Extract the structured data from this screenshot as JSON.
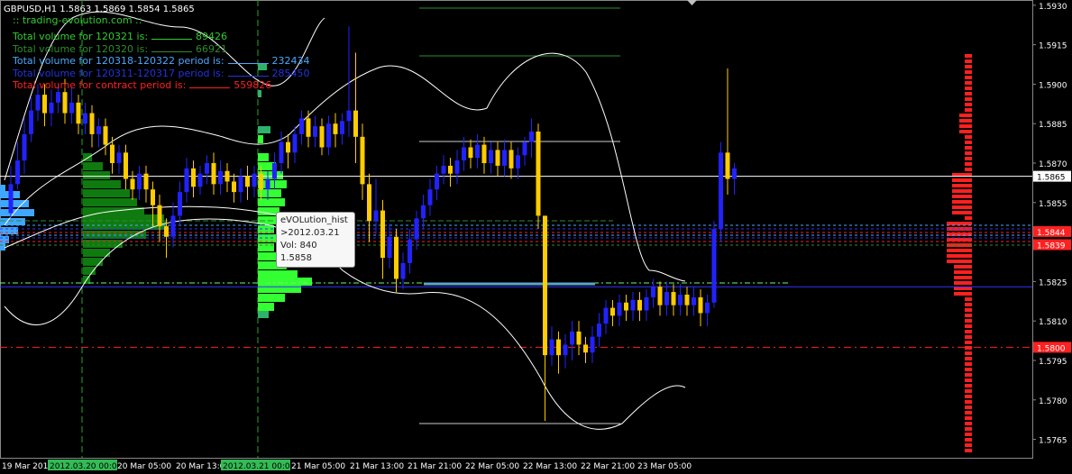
{
  "chart_data": {
    "type": "candlestick",
    "symbol_header": "GBPUSD,H1  1.5863 1.5869 1.5854 1.5865",
    "site_label": ":: trading-evolution.com ::",
    "volume_lines": [
      {
        "text": "Total volume for 120321 is:",
        "value": "89426",
        "color": "#32cd32"
      },
      {
        "text": "Total volume for 120320 is:",
        "value": "66921",
        "color": "#2e8b2e"
      },
      {
        "text": "Total volume for 120318-120322 period is:",
        "value": "232434",
        "color": "#4aa8ff"
      },
      {
        "text": "Total volume for 120311-120317 period is:",
        "value": "285450",
        "color": "#2233dd"
      },
      {
        "text": "Total volume for contract period is:",
        "value": "559826",
        "color": "#ff2020"
      }
    ],
    "y_axis": {
      "min": 1.5758,
      "max": 1.5932,
      "ticks": [
        "1.5930",
        "1.5915",
        "1.5900",
        "1.5885",
        "1.5870",
        "1.5855",
        "1.5840",
        "1.5825",
        "1.5810",
        "1.5795",
        "1.5780",
        "1.5765"
      ]
    },
    "x_labels": [
      {
        "text": "19 Mar 2012",
        "hl": false
      },
      {
        "text": "2012.03.20 00:00",
        "hl": true
      },
      {
        "text": "20 Mar 05:00",
        "hl": false
      },
      {
        "text": "20 Mar 13:00",
        "hl": false
      },
      {
        "text": "2012.03.21 00:00",
        "hl": true
      },
      {
        "text": "21 Mar 05:00",
        "hl": false
      },
      {
        "text": "21 Mar 13:00",
        "hl": false
      },
      {
        "text": "21 Mar 21:00",
        "hl": false
      },
      {
        "text": "22 Mar 05:00",
        "hl": false
      },
      {
        "text": "22 Mar 13:00",
        "hl": false
      },
      {
        "text": "22 Mar 21:00",
        "hl": false
      },
      {
        "text": "23 Mar 05:00",
        "hl": false
      }
    ],
    "price_labels": [
      {
        "text": "1.5865",
        "price": 1.5865,
        "bg": "#ffffff",
        "fg": "#000000"
      },
      {
        "text": "1.5844",
        "price": 1.5844,
        "bg": "#ff2020",
        "fg": "#ffffff"
      },
      {
        "text": "1.5839",
        "price": 1.5839,
        "bg": "#ff2020",
        "fg": "#ffffff"
      },
      {
        "text": "1.5800",
        "price": 1.58,
        "bg": "#ff2020",
        "fg": "#ffffff"
      }
    ],
    "levels": [
      {
        "price": 1.5865,
        "color": "#ffffff",
        "dash": false
      },
      {
        "price": 1.5823,
        "color": "#3333ff",
        "dash": false
      },
      {
        "price": 1.58,
        "color": "#ff2020",
        "dash": true
      }
    ],
    "candles": [
      [
        1.5851,
        1.5862,
        1.5849,
        1.5869
      ],
      [
        1.5862,
        1.5871,
        1.586,
        1.5878
      ],
      [
        1.5871,
        1.5881,
        1.5866,
        1.5887
      ],
      [
        1.5881,
        1.589,
        1.5878,
        1.5895
      ],
      [
        1.589,
        1.5896,
        1.5886,
        1.59
      ],
      [
        1.5896,
        1.5889,
        1.5884,
        1.59
      ],
      [
        1.5889,
        1.5893,
        1.5884,
        1.5898
      ],
      [
        1.5893,
        1.5897,
        1.5889,
        1.59
      ],
      [
        1.5897,
        1.5889,
        1.5885,
        1.5902
      ],
      [
        1.5889,
        1.5893,
        1.5885,
        1.5899
      ],
      [
        1.5893,
        1.5885,
        1.5881,
        1.5896
      ],
      [
        1.5885,
        1.5889,
        1.5881,
        1.5893
      ],
      [
        1.5889,
        1.5881,
        1.5876,
        1.5892
      ],
      [
        1.5881,
        1.5884,
        1.5876,
        1.5887
      ],
      [
        1.5884,
        1.5877,
        1.5873,
        1.5887
      ],
      [
        1.5877,
        1.587,
        1.5866,
        1.588
      ],
      [
        1.587,
        1.5874,
        1.5866,
        1.5877
      ],
      [
        1.5874,
        1.5864,
        1.586,
        1.5877
      ],
      [
        1.5864,
        1.586,
        1.5856,
        1.5867
      ],
      [
        1.586,
        1.5866,
        1.5856,
        1.5869
      ],
      [
        1.5866,
        1.586,
        1.5855,
        1.5869
      ],
      [
        1.586,
        1.5854,
        1.5846,
        1.5863
      ],
      [
        1.5854,
        1.5846,
        1.584,
        1.5858
      ],
      [
        1.5846,
        1.5842,
        1.5834,
        1.5849
      ],
      [
        1.5842,
        1.585,
        1.5838,
        1.5855
      ],
      [
        1.585,
        1.5859,
        1.5846,
        1.5863
      ],
      [
        1.5859,
        1.5868,
        1.5855,
        1.5872
      ],
      [
        1.5868,
        1.5861,
        1.5857,
        1.5871
      ],
      [
        1.5861,
        1.5866,
        1.5858,
        1.5869
      ],
      [
        1.5866,
        1.587,
        1.5862,
        1.5873
      ],
      [
        1.587,
        1.5862,
        1.5858,
        1.5874
      ],
      [
        1.5862,
        1.5867,
        1.5858,
        1.5871
      ],
      [
        1.5867,
        1.5863,
        1.5859,
        1.587
      ],
      [
        1.5863,
        1.5859,
        1.5855,
        1.5866
      ],
      [
        1.5859,
        1.5865,
        1.5855,
        1.5868
      ],
      [
        1.5865,
        1.5861,
        1.5856,
        1.5869
      ],
      [
        1.5861,
        1.5866,
        1.5857,
        1.5869
      ],
      [
        1.5866,
        1.586,
        1.5856,
        1.5869
      ],
      [
        1.586,
        1.5864,
        1.5856,
        1.5867
      ],
      [
        1.5864,
        1.587,
        1.586,
        1.5874
      ],
      [
        1.587,
        1.5878,
        1.5866,
        1.5882
      ],
      [
        1.5878,
        1.5874,
        1.5868,
        1.5881
      ],
      [
        1.5874,
        1.5881,
        1.587,
        1.5884
      ],
      [
        1.5881,
        1.5887,
        1.5877,
        1.589
      ],
      [
        1.5887,
        1.588,
        1.5876,
        1.589
      ],
      [
        1.588,
        1.5884,
        1.5876,
        1.5888
      ],
      [
        1.5884,
        1.5876,
        1.5873,
        1.5887
      ],
      [
        1.5876,
        1.5885,
        1.5873,
        1.5888
      ],
      [
        1.5885,
        1.5881,
        1.5876,
        1.5889
      ],
      [
        1.5881,
        1.5886,
        1.5877,
        1.5889
      ],
      [
        1.5886,
        1.589,
        1.588,
        1.5922
      ],
      [
        1.589,
        1.588,
        1.587,
        1.5912
      ],
      [
        1.588,
        1.5862,
        1.5856,
        1.5885
      ],
      [
        1.5862,
        1.5848,
        1.584,
        1.5866
      ],
      [
        1.5848,
        1.5852,
        1.5843,
        1.5864
      ],
      [
        1.5852,
        1.5834,
        1.5826,
        1.5856
      ],
      [
        1.5834,
        1.5842,
        1.583,
        1.5847
      ],
      [
        1.5842,
        1.5826,
        1.5821,
        1.5845
      ],
      [
        1.5826,
        1.5832,
        1.5822,
        1.5836
      ],
      [
        1.5832,
        1.5841,
        1.5828,
        1.5845
      ],
      [
        1.5841,
        1.5849,
        1.5837,
        1.5852
      ],
      [
        1.5849,
        1.5854,
        1.5845,
        1.5858
      ],
      [
        1.5854,
        1.586,
        1.585,
        1.5864
      ],
      [
        1.586,
        1.5866,
        1.5856,
        1.5869
      ],
      [
        1.5866,
        1.5869,
        1.5862,
        1.5873
      ],
      [
        1.5869,
        1.5866,
        1.5861,
        1.5872
      ],
      [
        1.5866,
        1.5871,
        1.5862,
        1.5875
      ],
      [
        1.5871,
        1.5876,
        1.5867,
        1.588
      ],
      [
        1.5876,
        1.5872,
        1.5868,
        1.5879
      ],
      [
        1.5872,
        1.5877,
        1.5868,
        1.5881
      ],
      [
        1.5877,
        1.587,
        1.5866,
        1.588
      ],
      [
        1.587,
        1.5875,
        1.5866,
        1.5878
      ],
      [
        1.5875,
        1.5869,
        1.5865,
        1.5878
      ],
      [
        1.5869,
        1.5875,
        1.5865,
        1.5879
      ],
      [
        1.5875,
        1.5868,
        1.5864,
        1.5878
      ],
      [
        1.5868,
        1.5873,
        1.5864,
        1.5876
      ],
      [
        1.5873,
        1.5878,
        1.5869,
        1.588
      ],
      [
        1.5878,
        1.5882,
        1.5872,
        1.5887
      ],
      [
        1.5882,
        1.585,
        1.5845,
        1.5885
      ],
      [
        1.585,
        1.5797,
        1.5772,
        1.585
      ],
      [
        1.5797,
        1.5803,
        1.5793,
        1.5808
      ],
      [
        1.5803,
        1.5797,
        1.579,
        1.5806
      ],
      [
        1.5797,
        1.5801,
        1.5792,
        1.5805
      ],
      [
        1.5801,
        1.5806,
        1.5795,
        1.581
      ],
      [
        1.5806,
        1.5801,
        1.5797,
        1.581
      ],
      [
        1.5801,
        1.5798,
        1.5794,
        1.5804
      ],
      [
        1.5798,
        1.5804,
        1.5794,
        1.5808
      ],
      [
        1.5804,
        1.5809,
        1.58,
        1.5813
      ],
      [
        1.5809,
        1.5815,
        1.5805,
        1.5818
      ],
      [
        1.5815,
        1.5812,
        1.5808,
        1.5818
      ],
      [
        1.5812,
        1.5817,
        1.5808,
        1.582
      ],
      [
        1.5817,
        1.5814,
        1.581,
        1.582
      ],
      [
        1.5814,
        1.5818,
        1.581,
        1.5821
      ],
      [
        1.5818,
        1.5814,
        1.581,
        1.5821
      ],
      [
        1.5814,
        1.5819,
        1.581,
        1.5822
      ],
      [
        1.5819,
        1.5823,
        1.5815,
        1.5826
      ],
      [
        1.5823,
        1.5816,
        1.5812,
        1.5825
      ],
      [
        1.5816,
        1.5821,
        1.5812,
        1.5825
      ],
      [
        1.5821,
        1.5816,
        1.5812,
        1.5824
      ],
      [
        1.5816,
        1.582,
        1.5812,
        1.5824
      ],
      [
        1.582,
        1.5816,
        1.5812,
        1.5823
      ],
      [
        1.5816,
        1.5819,
        1.5812,
        1.5823
      ],
      [
        1.5819,
        1.5813,
        1.5808,
        1.5822
      ],
      [
        1.5813,
        1.5817,
        1.5808,
        1.582
      ],
      [
        1.5817,
        1.5845,
        1.5815,
        1.5848
      ],
      [
        1.5845,
        1.5874,
        1.584,
        1.5878
      ],
      [
        1.5874,
        1.5864,
        1.5858,
        1.5906
      ],
      [
        1.5864,
        1.5868,
        1.5858,
        1.587
      ]
    ],
    "tooltip": {
      "title": "eVOLution_hist",
      "date": ">2012.03.21",
      "vol": "Vol: 840",
      "price": "1.5858"
    }
  }
}
